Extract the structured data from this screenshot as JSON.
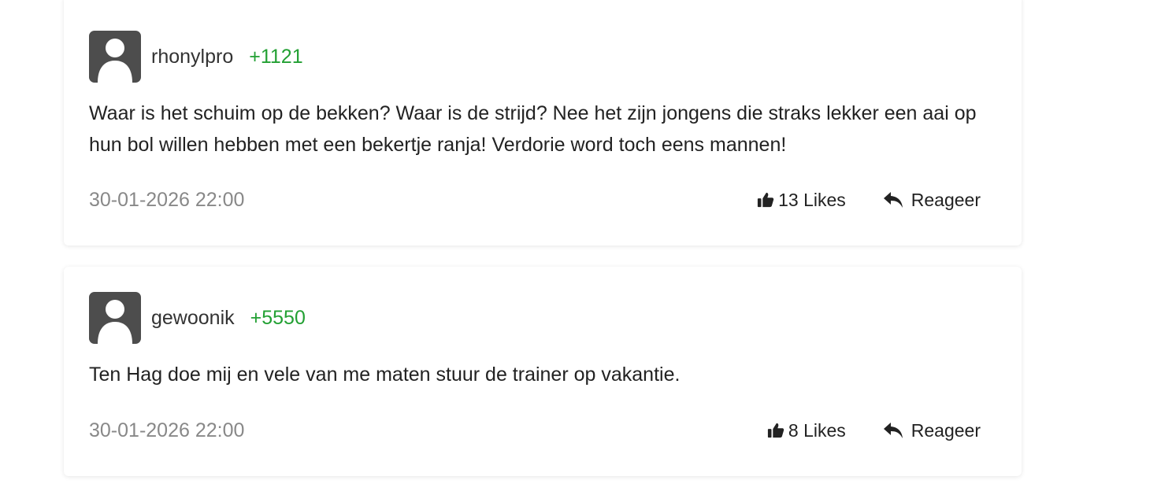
{
  "comments": [
    {
      "username": "rhonylpro",
      "points": "+1121",
      "text": "Waar is het schuim op de bekken? Waar is de strijd? Nee het zijn jongens die straks lekker een aai op hun bol willen hebben met een bekertje ranja! Verdorie word toch eens mannen!",
      "date": "30-01-2026 22:00",
      "likes_label": "13 Likes",
      "reply_label": "Reageer",
      "avatar_icon": "user-silhouette-icon",
      "like_icon": "thumbs-up-icon",
      "reply_icon": "reply-arrow-icon"
    },
    {
      "username": "gewoonik",
      "points": "+5550",
      "text": "Ten Hag doe mij en vele van me maten stuur de trainer op vakantie.",
      "date": "30-01-2026 22:00",
      "likes_label": "8 Likes",
      "reply_label": "Reageer",
      "avatar_icon": "user-silhouette-icon",
      "like_icon": "thumbs-up-icon",
      "reply_icon": "reply-arrow-icon"
    }
  ],
  "colors": {
    "points": "#22a033",
    "avatar_bg": "#4d4d4d",
    "date": "#888888"
  }
}
